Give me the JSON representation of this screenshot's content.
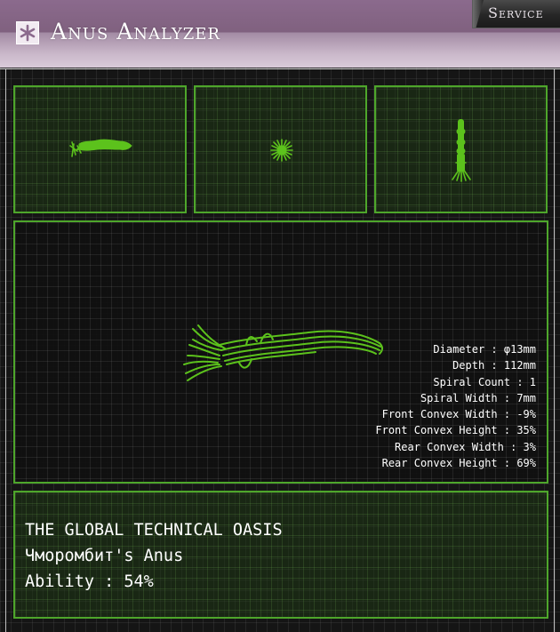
{
  "header": {
    "title": "Anus Analyzer",
    "service_label": "Service"
  },
  "colors": {
    "accent_green": "#4ea62b",
    "shape_green": "#5cc21c",
    "header_purple": "#8b6a8d"
  },
  "stats": {
    "diameter": "Diameter : φ13mm",
    "depth": "Depth : 112mm",
    "spiral_count": "Spiral Count : 1",
    "spiral_width": "Spiral Width : 7mm",
    "front_convex_width": "Front Convex Width : -9%",
    "front_convex_height": "Front Convex Height : 35%",
    "rear_convex_width": "Rear Convex Width : 3%",
    "rear_convex_height": "Rear Convex Height : 69%"
  },
  "info": {
    "line1": "THE GLOBAL TECHNICAL OASIS",
    "line2": "Чморомбит's Anus",
    "line3": "Ability : 54%"
  },
  "icons": {
    "logo": "asterisk-logo-icon"
  }
}
